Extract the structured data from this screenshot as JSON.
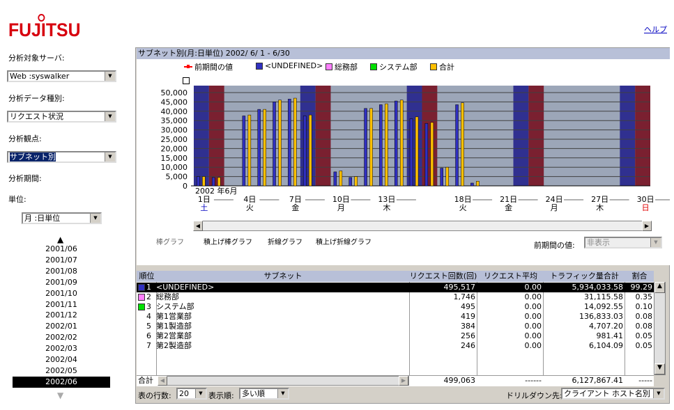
{
  "header": {
    "logo": "FUJITSU",
    "help": "ヘルプ"
  },
  "sidebar": {
    "server_label": "分析対象サーバ:",
    "server_value": "Web  :syswalker",
    "datatype_label": "分析データ種別:",
    "datatype_value": "リクエスト状況",
    "view_label": "分析観点:",
    "view_value": "サブネット別",
    "period_label": "分析期間:",
    "unit_label": "単位:",
    "unit_value": "月  :日単位",
    "months": [
      "2001/06",
      "2001/07",
      "2001/08",
      "2001/09",
      "2001/10",
      "2001/11",
      "2001/12",
      "2002/01",
      "2002/02",
      "2002/03",
      "2002/04",
      "2002/05",
      "2002/06"
    ],
    "active_month": "2002/06"
  },
  "chart_panel": {
    "title": "サブネット別(月:日単位) 2002/ 6/ 1 -  6/30",
    "legend": [
      {
        "label": "前期間の値",
        "color": "#ff0000",
        "type": "line"
      },
      {
        "label": "<UNDEFINED>",
        "color": "#3030c0"
      },
      {
        "label": "総務部",
        "color": "#ff80ff"
      },
      {
        "label": "システム部",
        "color": "#00e000"
      },
      {
        "label": "合計",
        "color": "#ffc000"
      }
    ],
    "year_month": "2002 年6月",
    "x_ticks": [
      {
        "day": "1日",
        "dow": "土",
        "dowColor": "#0000c0",
        "i": 0
      },
      {
        "day": "4日",
        "dow": "火",
        "dowColor": "#000",
        "i": 3
      },
      {
        "day": "7日",
        "dow": "金",
        "dowColor": "#000",
        "i": 6
      },
      {
        "day": "10日",
        "dow": "月",
        "dowColor": "#000",
        "i": 9
      },
      {
        "day": "13日",
        "dow": "木",
        "dowColor": "#000",
        "i": 12
      },
      {
        "day": "18日",
        "dow": "火",
        "dowColor": "#000",
        "i": 17
      },
      {
        "day": "21日",
        "dow": "金",
        "dowColor": "#000",
        "i": 20
      },
      {
        "day": "24日",
        "dow": "月",
        "dowColor": "#000",
        "i": 23
      },
      {
        "day": "27日",
        "dow": "木",
        "dowColor": "#000",
        "i": 26
      },
      {
        "day": "30日",
        "dow": "日",
        "dowColor": "#e00000",
        "i": 29
      }
    ],
    "tabs": [
      "棒グラフ",
      "積上げ棒グラフ",
      "折線グラフ",
      "積上げ折線グラフ"
    ],
    "prev_label": "前期間の値:",
    "prev_value": "非表示"
  },
  "chart_data": {
    "type": "bar",
    "categories": [
      "1日",
      "2日",
      "3日",
      "4日",
      "5日",
      "6日",
      "7日",
      "8日",
      "9日",
      "10日",
      "11日",
      "12日",
      "13日",
      "14日",
      "15日",
      "16日",
      "17日",
      "18日",
      "19日",
      "20日",
      "21日",
      "22日",
      "23日",
      "24日",
      "25日",
      "26日",
      "27日",
      "28日",
      "29日",
      "30日"
    ],
    "ylim": [
      0,
      50000
    ],
    "y_ticks": [
      "0",
      "5,000",
      "10,000",
      "15,000",
      "20,000",
      "25,000",
      "30,000",
      "35,000",
      "40,000",
      "45,000",
      "50,000"
    ],
    "weekend_days": [
      1,
      2,
      8,
      9,
      15,
      16,
      22,
      23,
      29,
      30
    ],
    "series": [
      {
        "name": "<UNDEFINED>",
        "color": "#3030c0",
        "values": [
          5000,
          4500,
          0,
          37500,
          41000,
          45000,
          46500,
          37500,
          0,
          7500,
          4500,
          41500,
          43500,
          45500,
          36000,
          33500,
          9500,
          43500,
          1500,
          0,
          0,
          0,
          0,
          0,
          0,
          0,
          0,
          0,
          0,
          0
        ]
      },
      {
        "name": "合計",
        "color": "#ffc000",
        "values": [
          5000,
          4500,
          0,
          38000,
          41000,
          46000,
          47000,
          38000,
          0,
          8000,
          5000,
          41500,
          44000,
          46000,
          37000,
          34000,
          10000,
          44500,
          2500,
          0,
          0,
          0,
          0,
          0,
          0,
          0,
          0,
          0,
          0,
          0
        ]
      }
    ]
  },
  "table": {
    "headers": [
      "順位",
      "サブネット",
      "リクエスト回数(回)",
      "リクエスト平均(秒)",
      "トラフィック量合計(KB)",
      "割合(%)"
    ],
    "rows": [
      {
        "rank": "1",
        "name": "<UNDEFINED>",
        "count": "495,517",
        "avg": "0.00",
        "traffic": "5,934,033.58",
        "pct": "99.29",
        "color": "#3030c0"
      },
      {
        "rank": "2",
        "name": "総務部",
        "count": "1,746",
        "avg": "0.00",
        "traffic": "31,115.58",
        "pct": "0.35",
        "color": "#ff80ff"
      },
      {
        "rank": "3",
        "name": "システム部",
        "count": "495",
        "avg": "0.00",
        "traffic": "14,092.55",
        "pct": "0.10",
        "color": "#00e000"
      },
      {
        "rank": "4",
        "name": "第1営業部",
        "count": "419",
        "avg": "0.00",
        "traffic": "136,833.03",
        "pct": "0.08",
        "color": ""
      },
      {
        "rank": "5",
        "name": "第1製造部",
        "count": "384",
        "avg": "0.00",
        "traffic": "4,707.20",
        "pct": "0.08",
        "color": ""
      },
      {
        "rank": "6",
        "name": "第2営業部",
        "count": "256",
        "avg": "0.00",
        "traffic": "981.41",
        "pct": "0.05",
        "color": ""
      },
      {
        "rank": "7",
        "name": "第2製造部",
        "count": "246",
        "avg": "0.00",
        "traffic": "6,104.09",
        "pct": "0.05",
        "color": ""
      }
    ],
    "total_label": "合計",
    "total_count": "499,063",
    "total_avg": "------",
    "total_traffic": "6,127,867.41",
    "total_pct": "-----"
  },
  "footer": {
    "rows_label": "表の行数:",
    "rows_value": "20",
    "order_label": "表示順:",
    "order_value": "多い順",
    "drill_label": "ドリルダウン先:",
    "drill_value": "クライアント ホスト名別"
  }
}
